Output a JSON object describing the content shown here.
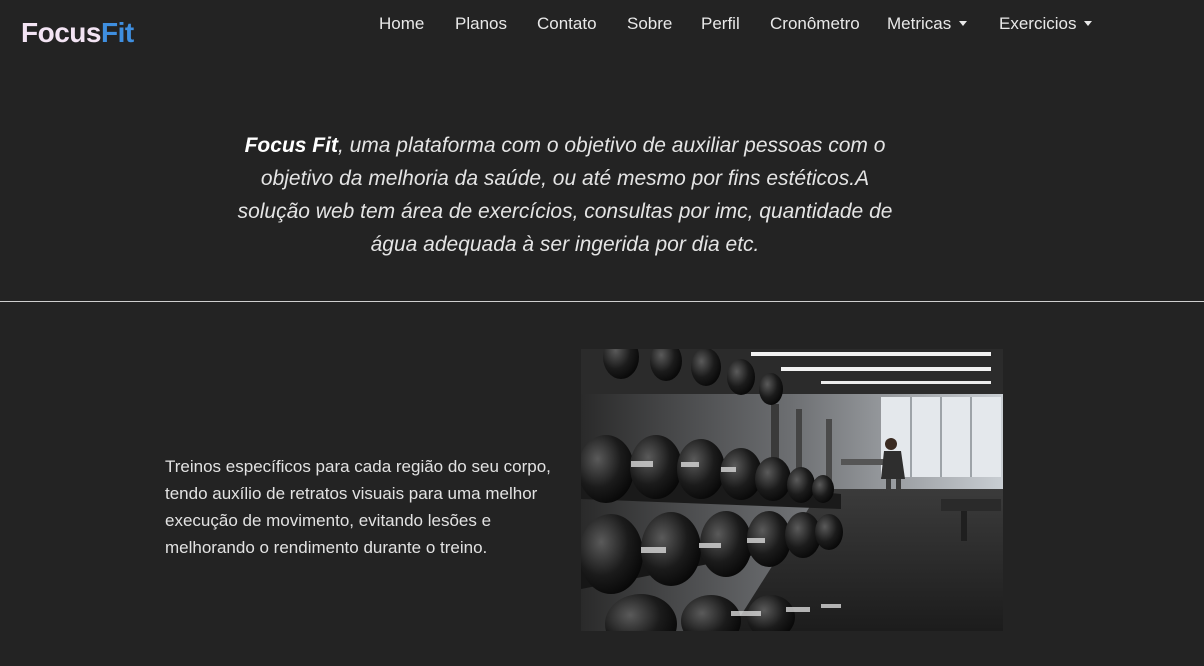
{
  "brand": {
    "part1": "Focus",
    "part2": "Fit"
  },
  "nav": {
    "home": "Home",
    "planos": "Planos",
    "contato": "Contato",
    "sobre": "Sobre",
    "perfil": "Perfil",
    "cronometro": "Cronômetro",
    "metricas": "Metricas",
    "exercicios": "Exercicios"
  },
  "intro": {
    "bold": "Focus Fit",
    "text": ", uma plataforma com o objetivo de auxiliar pessoas com o objetivo da melhoria da saúde, ou até mesmo por fins estéticos.A solução web tem área de exercícios, consultas por imc, quantidade de água adequada à ser ingerida por dia etc."
  },
  "feature": {
    "text": "Treinos específicos para cada região do seu corpo, tendo auxílio de retratos visuais para uma melhor execução de movimento, evitando lesões e melhorando o rendimento durante o treino.",
    "image": "gym-dumbbell-rack-photo"
  },
  "colors": {
    "background": "#232323",
    "brand_primary": "#f3e4f4",
    "brand_accent": "#3f8fe0",
    "text": "#e8e8e8"
  }
}
